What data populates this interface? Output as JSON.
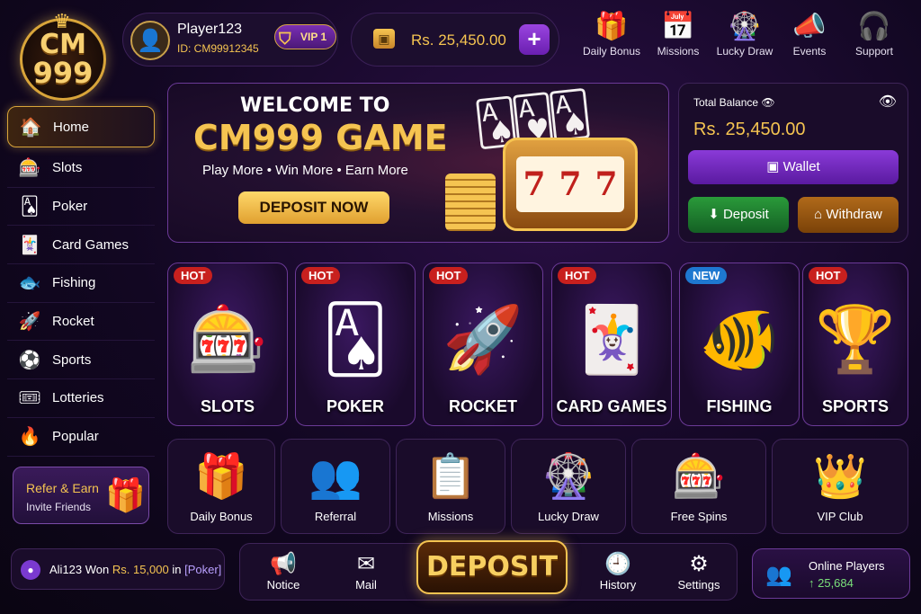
{
  "logo": {
    "line1": "CM",
    "line2": "999"
  },
  "profile": {
    "name": "Player123",
    "id": "ID: CM99912345",
    "vip": "VIP 1"
  },
  "top_balance": {
    "amount": "Rs. 25,450.00",
    "add": "+"
  },
  "top_actions": [
    {
      "label": "Daily Bonus",
      "icon": "gift-icon"
    },
    {
      "label": "Missions",
      "icon": "calendar-check-icon"
    },
    {
      "label": "Lucky Draw",
      "icon": "wheel-icon"
    },
    {
      "label": "Events",
      "icon": "megaphone-icon"
    },
    {
      "label": "Support",
      "icon": "headset-icon"
    }
  ],
  "sidebar": {
    "items": [
      {
        "label": "Home",
        "icon": "home-icon"
      },
      {
        "label": "Slots",
        "icon": "slot-icon"
      },
      {
        "label": "Poker",
        "icon": "cards-icon"
      },
      {
        "label": "Card Games",
        "icon": "playing-cards-icon"
      },
      {
        "label": "Fishing",
        "icon": "fish-icon"
      },
      {
        "label": "Rocket",
        "icon": "rocket-icon"
      },
      {
        "label": "Sports",
        "icon": "soccer-ball-icon"
      },
      {
        "label": "Lotteries",
        "icon": "ticket-icon"
      },
      {
        "label": "Popular",
        "icon": "fire-icon"
      }
    ],
    "refer": {
      "title": "Refer & Earn",
      "subtitle": "Invite Friends"
    }
  },
  "hero": {
    "welcome": "WELCOME TO",
    "title": "CM999 GAME",
    "tagline": "Play More • Win More • Earn More",
    "cta": "DEPOSIT NOW",
    "slot_symbols": [
      "7",
      "7",
      "7"
    ]
  },
  "balance_panel": {
    "label": "Total Balance",
    "amount": "Rs. 25,450.00",
    "wallet": "Wallet",
    "deposit": "Deposit",
    "withdraw": "Withdraw"
  },
  "games": [
    {
      "name": "SLOTS",
      "badge": "HOT",
      "icon": "slot-machine-icon"
    },
    {
      "name": "POKER",
      "badge": "HOT",
      "icon": "poker-chips-icon"
    },
    {
      "name": "ROCKET",
      "badge": "HOT",
      "icon": "rocket-icon"
    },
    {
      "name": "CARD GAMES",
      "badge": "HOT",
      "icon": "playing-cards-icon"
    },
    {
      "name": "FISHING",
      "badge": "NEW",
      "icon": "fish-icon"
    },
    {
      "name": "SPORTS",
      "badge": "HOT",
      "icon": "trophy-icon"
    }
  ],
  "features": [
    {
      "name": "Daily Bonus",
      "icon": "gift-icon"
    },
    {
      "name": "Referral",
      "icon": "users-icon"
    },
    {
      "name": "Missions",
      "icon": "clipboard-icon"
    },
    {
      "name": "Lucky Draw",
      "icon": "wheel-icon"
    },
    {
      "name": "Free Spins",
      "icon": "slot-machine-icon"
    },
    {
      "name": "VIP Club",
      "icon": "crown-icon"
    }
  ],
  "ticker": {
    "prefix": "Ali123 Won ",
    "amount": "Rs. 15,000",
    "mid": " in ",
    "game": "[Poker]"
  },
  "bottom_nav": {
    "notice": "Notice",
    "mail": "Mail",
    "deposit": "DEPOSIT",
    "history": "History",
    "settings": "Settings"
  },
  "online": {
    "label": "Online Players",
    "count": "↑ 25,684"
  },
  "colors": {
    "gold": "#f5c451",
    "purple": "#7a2fb5",
    "bg": "#120722",
    "hot": "#c8201e",
    "new": "#1e78d0"
  }
}
